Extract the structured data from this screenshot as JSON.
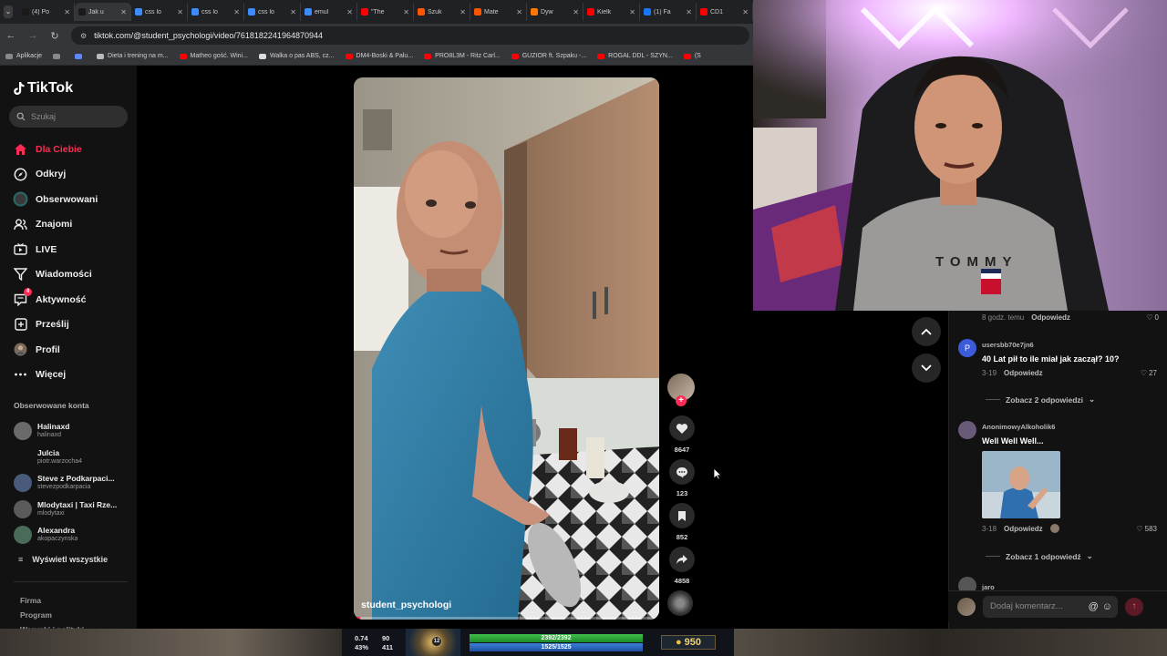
{
  "browser": {
    "tabs": [
      {
        "title": "(4) Po",
        "color": "#1a1a1a"
      },
      {
        "title": "Jak u",
        "color": "#1a1a1a"
      },
      {
        "title": "css lo",
        "color": "#3c8cff"
      },
      {
        "title": "css lo",
        "color": "#3c8cff"
      },
      {
        "title": "css lo",
        "color": "#3c8cff"
      },
      {
        "title": "emul",
        "color": "#3c8cff"
      },
      {
        "title": "\"The",
        "color": "#ff0000"
      },
      {
        "title": "Szuk",
        "color": "#ff5500"
      },
      {
        "title": "Mate",
        "color": "#ff5500"
      },
      {
        "title": "Dyw",
        "color": "#ff7700"
      },
      {
        "title": "Kielk",
        "color": "#ff0000"
      },
      {
        "title": "(1) Fa",
        "color": "#1877f2"
      },
      {
        "title": "CD1",
        "color": "#ff0000"
      }
    ],
    "url": "tiktok.com/@student_psychologi/video/7618182241964870944",
    "bookmarks": [
      {
        "label": "Aplikacje",
        "color": "#888888"
      },
      {
        "label": "",
        "color": "#888888"
      },
      {
        "label": "",
        "color": "#5f8aff"
      },
      {
        "label": "Dieta i trening na m...",
        "color": "#bbbbbb"
      },
      {
        "label": "Matheo gość. Wini...",
        "color": "#ff0000"
      },
      {
        "label": "Walka o pas ABS, cz...",
        "color": "#dddddd"
      },
      {
        "label": "DM4-Boski & Palu...",
        "color": "#ff0000"
      },
      {
        "label": "PRO8L3M - Ritz Carl...",
        "color": "#ff0000"
      },
      {
        "label": "GUZIOR ft. Szpaku -...",
        "color": "#ff0000"
      },
      {
        "label": "ROGAL DDL - SZYN...",
        "color": "#ff0000"
      },
      {
        "label": "(S",
        "color": "#ff0000"
      }
    ]
  },
  "sidebar": {
    "logo": "TikTok",
    "search_placeholder": "Szukaj",
    "nav": [
      {
        "label": "Dla Ciebie",
        "icon": "home-icon",
        "active": true
      },
      {
        "label": "Odkryj",
        "icon": "compass-icon",
        "active": false
      },
      {
        "label": "Obserwowani",
        "icon": "following-icon",
        "active": false
      },
      {
        "label": "Znajomi",
        "icon": "friends-icon",
        "active": false
      },
      {
        "label": "LIVE",
        "icon": "live-icon",
        "active": false
      },
      {
        "label": "Wiadomości",
        "icon": "messages-icon",
        "active": false
      },
      {
        "label": "Aktywność",
        "icon": "activity-icon",
        "active": false,
        "badge": "4"
      },
      {
        "label": "Prześlij",
        "icon": "upload-icon",
        "active": false
      },
      {
        "label": "Profil",
        "icon": "profile-icon",
        "active": false
      },
      {
        "label": "Więcej",
        "icon": "more-icon",
        "active": false
      }
    ],
    "followed_title": "Obserwowane konta",
    "followed": [
      {
        "name": "Halinaxd",
        "user": "halinaxd",
        "color": "#6a6a6a"
      },
      {
        "name": "Julcia",
        "user": "piotr.warzocha4",
        "color": "#121212"
      },
      {
        "name": "Steve z Podkarpaci...",
        "user": "stevezpodkarpacia",
        "color": "#4a5a7a"
      },
      {
        "name": "Mlodytaxi | Taxi Rze...",
        "user": "mlodytaxi",
        "color": "#5a5a5a"
      },
      {
        "name": "Alexandra",
        "user": "akopaczynska",
        "color": "#4a6a5a"
      }
    ],
    "see_all": "Wyświetl wszystkie",
    "footer": [
      "Firma",
      "Program",
      "Warunki i polityki"
    ]
  },
  "video": {
    "username": "student_psychologi",
    "progress": 0.02,
    "likes": "8647",
    "comments": "123",
    "saves": "852",
    "shares": "4858"
  },
  "comments": {
    "top_meta": {
      "time": "8 godz. temu",
      "reply": "Odpowiedz",
      "likes": "0"
    },
    "items": [
      {
        "user": "usersbb70e7jn6",
        "avatar_letter": "P",
        "avatar_color": "#3b5bdb",
        "text": "40 Lat pił to ile miał jak zaczął? 10?",
        "date": "3-19",
        "reply": "Odpowiedz",
        "likes": "27",
        "more": "Zobacz 2 odpowiedzi"
      },
      {
        "user": "AnonimowyAlkoholik6",
        "avatar_letter": "",
        "avatar_color": "#6a5a7a",
        "text": "Well Well Well...",
        "date": "3-18",
        "reply": "Odpowiedz",
        "likes": "583",
        "more": "Zobacz 1 odpowiedź"
      }
    ],
    "partial_user": "jaro",
    "input_placeholder": "Dodaj komentarz..."
  },
  "game_hud": {
    "stat1": "0.74",
    "stat2": "90",
    "stat3": "43%",
    "stat4": "411",
    "level": "12",
    "hp": "2392/2392",
    "mp": "1525/1525",
    "gold": "950"
  }
}
